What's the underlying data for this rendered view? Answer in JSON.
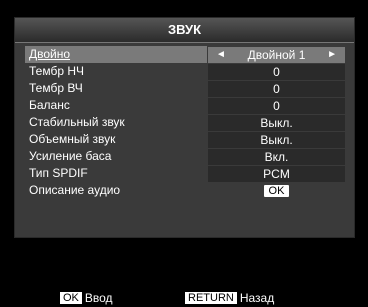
{
  "menu": {
    "title": "ЗВУК",
    "items": [
      {
        "label": "Двойно",
        "value": "Двойной 1",
        "selected": true,
        "type": "selector"
      },
      {
        "label": "Тембр НЧ",
        "value": "0"
      },
      {
        "label": "Тембр ВЧ",
        "value": "0"
      },
      {
        "label": "Баланс",
        "value": "0"
      },
      {
        "label": "Стабильный звук",
        "value": "Выкл."
      },
      {
        "label": "Объемный звук",
        "value": "Выкл."
      },
      {
        "label": "Усиление баса",
        "value": "Вкл."
      },
      {
        "label": "Тип SPDIF",
        "value": "PCM"
      },
      {
        "label": "Описание аудио",
        "value": "OK",
        "type": "button"
      }
    ]
  },
  "arrows": {
    "left": "◄",
    "right": "►"
  },
  "footer": {
    "ok_key": "OK",
    "ok_action": "Ввод",
    "return_key": "RETURN",
    "return_action": "Назад"
  },
  "colors": {
    "background": "#000000",
    "menu_bg": "#3a3a3a",
    "value_cell": "#2a2a2a",
    "selected": "#7a7a7a",
    "text": "#ffffff"
  }
}
